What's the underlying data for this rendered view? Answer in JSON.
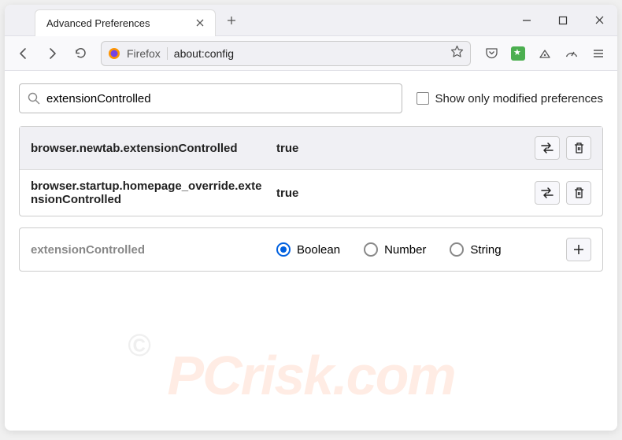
{
  "tab": {
    "title": "Advanced Preferences"
  },
  "urlbar": {
    "identity": "Firefox",
    "url": "about:config"
  },
  "search": {
    "value": "extensionControlled",
    "checkbox_label": "Show only modified preferences"
  },
  "prefs": [
    {
      "name": "browser.newtab.extensionControlled",
      "value": "true"
    },
    {
      "name": "browser.startup.homepage_override.extensionControlled",
      "value": "true"
    }
  ],
  "add_row": {
    "name": "extensionControlled",
    "types": [
      "Boolean",
      "Number",
      "String"
    ],
    "selected": "Boolean"
  },
  "watermark": "PCrisk.com"
}
